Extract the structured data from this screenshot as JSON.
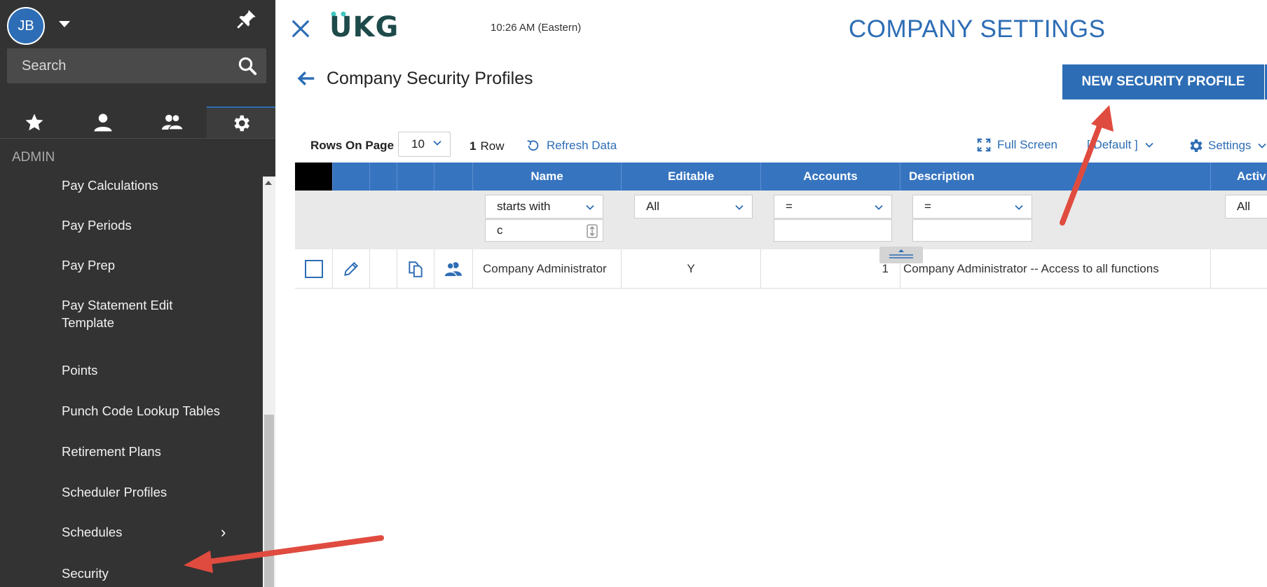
{
  "sidebar": {
    "user_initials": "JB",
    "search_label": "Search",
    "tabs": [
      {
        "icon": "star-icon"
      },
      {
        "icon": "person-icon"
      },
      {
        "icon": "people-icon"
      },
      {
        "icon": "gear-icon",
        "active": true
      }
    ],
    "section": "ADMIN",
    "items": [
      {
        "label": "Pay Calculations"
      },
      {
        "label": "Pay Periods"
      },
      {
        "label": "Pay Prep"
      },
      {
        "label": "Pay Statement Edit Template"
      },
      {
        "label": "Points"
      },
      {
        "label": "Punch Code Lookup Tables"
      },
      {
        "label": "Retirement Plans"
      },
      {
        "label": "Scheduler Profiles"
      },
      {
        "label": "Schedules",
        "has_submenu": true
      },
      {
        "label": "Security"
      }
    ]
  },
  "header": {
    "logo": "UKG",
    "time": "10:26 AM (Eastern)",
    "page_title": "COMPANY SETTINGS",
    "subtitle": "Company Security Profiles",
    "new_button": "NEW SECURITY PROFILE"
  },
  "toolbar": {
    "rows_on_page_label": "Rows On Page",
    "rows_on_page_value": "10",
    "row_count": "1",
    "row_count_label": "Row",
    "refresh": "Refresh Data",
    "full_screen": "Full Screen",
    "view": "[ Default ]",
    "settings": "Settings"
  },
  "grid": {
    "columns": [
      "Name",
      "Editable",
      "Accounts",
      "Description",
      "Activ"
    ],
    "filters": {
      "name_op": "starts with",
      "name_value": "c",
      "editable": "All",
      "accounts_op": "=",
      "description_op": "=",
      "active": "All"
    },
    "rows": [
      {
        "name": "Company Administrator",
        "editable": "Y",
        "accounts": "1",
        "description": "Company Administrator -- Access to all functions"
      }
    ]
  },
  "colors": {
    "accent": "#2d6db5",
    "header_blue": "#3774c0",
    "sidebar_bg": "#333333",
    "annotation_arrow": "#e04b3f"
  }
}
